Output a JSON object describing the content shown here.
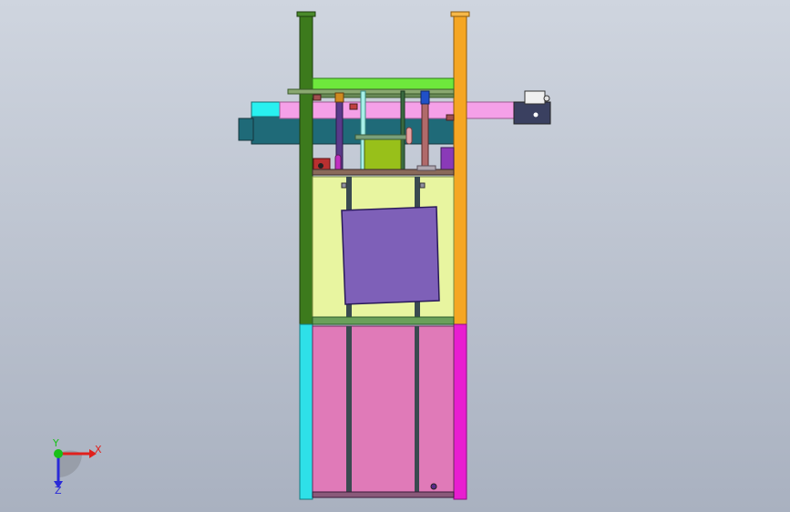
{
  "viewport": {
    "background_top": "#cfd5df",
    "background_bottom": "#a9b1c0"
  },
  "triad": {
    "x_label": "X",
    "y_label": "Y",
    "z_label": "Z",
    "x_color": "#e0201c",
    "y_color": "#18c018",
    "z_color": "#2a2ad8"
  },
  "model": {
    "colors": {
      "left_column": "#3c7a1c",
      "right_column": "#f5a623",
      "left_base": "#2ee0e8",
      "right_base": "#e81ed0",
      "top_beam": "#6ee83c",
      "conveyor_pink": "#f5a0e8",
      "conveyor_dark": "#1f6a78",
      "conveyor_cyan": "#28f0f0",
      "mid_panel": "#e8f5a0",
      "plate": "#7e60b8",
      "lower_panel": "#e07ab8",
      "frame_dark": "#3a4a50",
      "olive": "#98c01a",
      "lid_end": "#3a4060",
      "bolt": "#9090a0"
    }
  }
}
